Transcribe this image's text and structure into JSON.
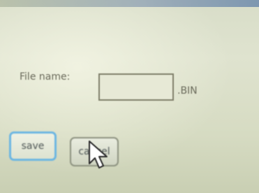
{
  "form": {
    "file_name_label": "File name:",
    "file_name_value": "",
    "extension": ".BIN"
  },
  "buttons": {
    "save_label": "save",
    "cancel_label": "cancel"
  },
  "colors": {
    "background": "#dbe0ca",
    "focus_ring": "#6cb6e2"
  },
  "icons": {
    "pointer": "arrow-cursor-icon"
  }
}
